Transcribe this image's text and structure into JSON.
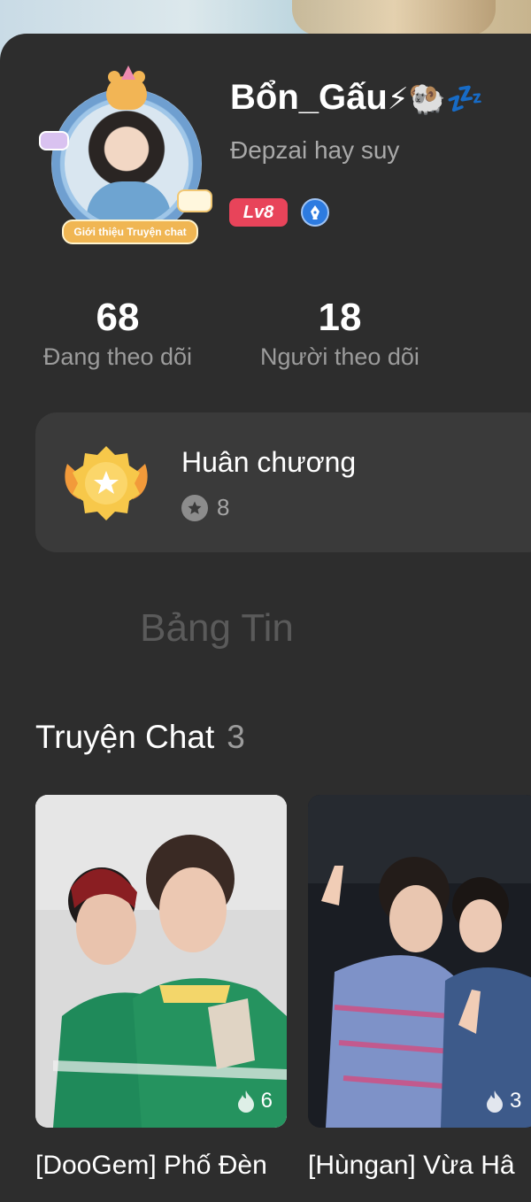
{
  "profile": {
    "username": "Bổn_Gấu",
    "name_emoji": "⚡🐏💤",
    "bio": "Đepzai hay suy",
    "level": "Lv8",
    "avatar_label": "Giới thiệu Truyện chat"
  },
  "stats": {
    "following": {
      "value": "68",
      "label": "Đang theo dõi"
    },
    "followers": {
      "value": "18",
      "label": "Người theo dõi"
    }
  },
  "medal": {
    "title": "Huân chương",
    "count": "8"
  },
  "board": {
    "title": "Bảng Tin"
  },
  "stories": {
    "title": "Truyện Chat",
    "count": "3",
    "items": [
      {
        "title": "[DooGem] Phố Đèn",
        "views": "6"
      },
      {
        "title": "[Hùngan] Vừa Hâ",
        "views": "3"
      }
    ]
  },
  "colors": {
    "background": "#2b2b2b",
    "card": "#3a3a3a",
    "level_badge": "#e8445a",
    "creator_badge": "#2d7be0",
    "muted_text": "#9c9c9c"
  },
  "icons": [
    "pen-nib-icon",
    "medal-icon",
    "star-icon",
    "fire-icon"
  ]
}
